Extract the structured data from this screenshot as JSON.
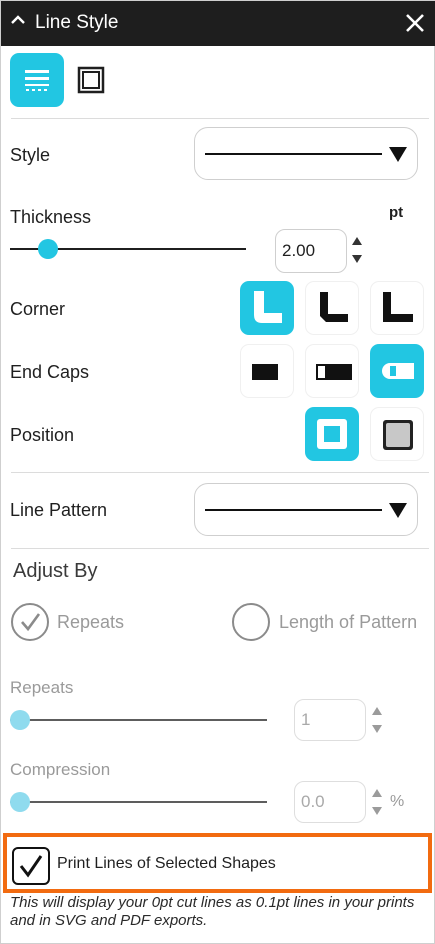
{
  "window": {
    "title": "Line Style"
  },
  "tabs": [
    {
      "name": "stroke-tab",
      "active": true
    },
    {
      "name": "fill-tab",
      "active": false
    }
  ],
  "style_row": {
    "label": "Style",
    "value": "solid-line"
  },
  "thickness": {
    "label": "Thickness",
    "unit": "pt",
    "value": "2.00",
    "slider_fraction": 0.12
  },
  "corner": {
    "label": "Corner",
    "options": [
      "round",
      "bevel",
      "miter"
    ],
    "selected": 0
  },
  "end_caps": {
    "label": "End Caps",
    "options": [
      "butt",
      "square",
      "round"
    ],
    "selected": 2
  },
  "position": {
    "label": "Position",
    "options": [
      "inside",
      "outside"
    ],
    "selected": 0
  },
  "line_pattern": {
    "label": "Line Pattern",
    "value": "solid-line"
  },
  "adjust_by": {
    "heading": "Adjust By",
    "options": [
      "Repeats",
      "Length of Pattern"
    ],
    "selected": 0
  },
  "repeats": {
    "label": "Repeats",
    "value": "1",
    "slider_fraction": 0.0
  },
  "compression": {
    "label": "Compression",
    "value": "0.0",
    "unit": "%",
    "slider_fraction": 0.0
  },
  "print_lines": {
    "label": "Print Lines of Selected Shapes",
    "checked": true
  },
  "note": "This will display your 0pt cut lines as 0.1pt lines in your prints and in SVG and PDF exports.",
  "colors": {
    "accent": "#22c6e2",
    "highlight": "#f26b10",
    "titlebar": "#1e1e1e"
  }
}
